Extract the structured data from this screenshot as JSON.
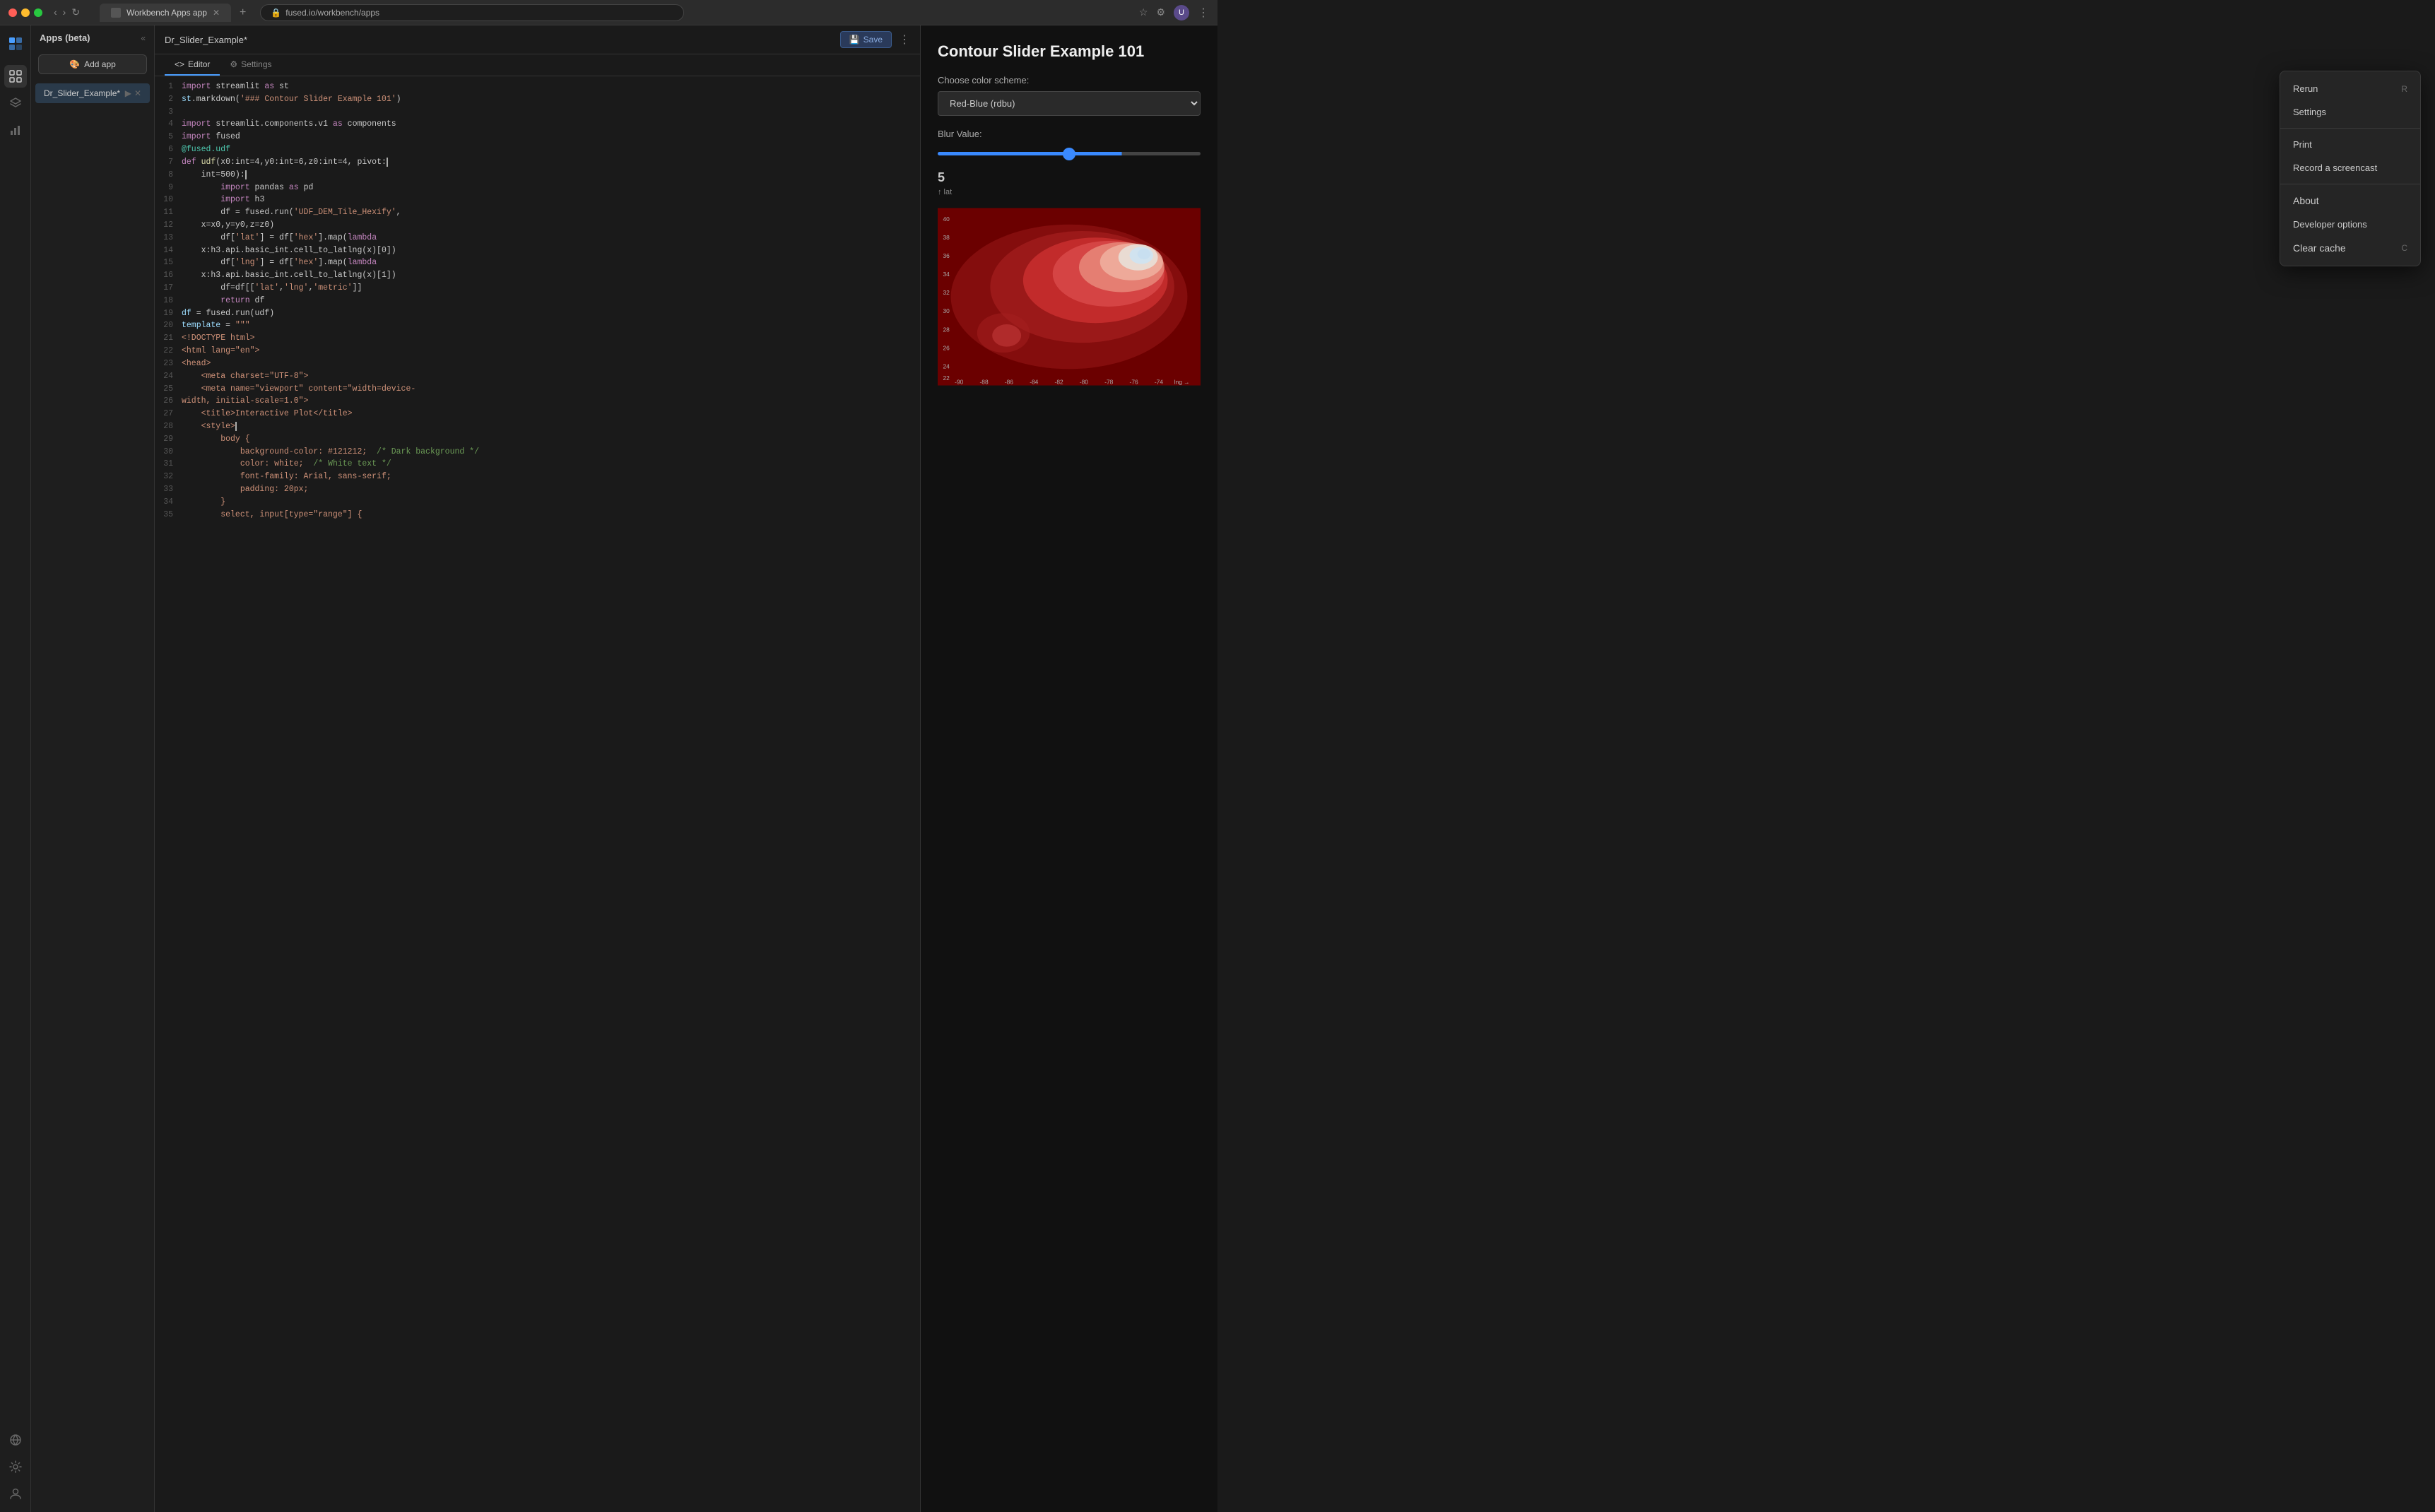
{
  "browser": {
    "tab_title": "Workbench Apps app",
    "url": "fused.io/workbench/apps",
    "new_tab_label": "+"
  },
  "sidebar": {
    "icons": [
      "grid",
      "layers",
      "chart",
      "tag",
      "globe",
      "settings",
      "user"
    ]
  },
  "left_panel": {
    "title": "Apps (beta)",
    "collapse_label": "«",
    "add_app_label": "Add app",
    "app_item": {
      "name": "Dr_Slider_Example*",
      "active": true
    }
  },
  "editor": {
    "filename": "Dr_Slider_Example*",
    "save_label": "Save",
    "menu_label": "⋮",
    "tabs": [
      {
        "label": "Editor",
        "icon": "<>",
        "active": true
      },
      {
        "label": "Settings",
        "icon": "⚙",
        "active": false
      }
    ],
    "lines": [
      {
        "num": 1,
        "tokens": [
          {
            "t": "kw",
            "v": "import"
          },
          {
            "t": "op",
            "v": " streamlit "
          },
          {
            "t": "kw",
            "v": "as"
          },
          {
            "t": "op",
            "v": " st"
          }
        ]
      },
      {
        "num": 2,
        "tokens": [
          {
            "t": "var",
            "v": "st"
          },
          {
            "t": "op",
            "v": ".markdown("
          },
          {
            "t": "str",
            "v": "'### Contour Slider Example 101'"
          },
          {
            "t": "op",
            "v": ")"
          }
        ]
      },
      {
        "num": 3,
        "tokens": []
      },
      {
        "num": 4,
        "tokens": [
          {
            "t": "kw",
            "v": "import"
          },
          {
            "t": "op",
            "v": " streamlit.components.v1 "
          },
          {
            "t": "kw",
            "v": "as"
          },
          {
            "t": "op",
            "v": " components"
          }
        ]
      },
      {
        "num": 5,
        "tokens": [
          {
            "t": "kw",
            "v": "import"
          },
          {
            "t": "op",
            "v": " fused"
          }
        ]
      },
      {
        "num": 6,
        "tokens": [
          {
            "t": "dec",
            "v": "@fused.udf"
          }
        ]
      },
      {
        "num": 7,
        "tokens": [
          {
            "t": "kw",
            "v": "def"
          },
          {
            "t": "op",
            "v": " "
          },
          {
            "t": "fn",
            "v": "udf"
          },
          {
            "t": "op",
            "v": "(x0:int=4,y0:int=6,z0:int=4, pivot:"
          }
        ]
      },
      {
        "num": 8,
        "tokens": [
          {
            "t": "op",
            "v": "    int=500):"
          }
        ]
      },
      {
        "num": 9,
        "tokens": [
          {
            "t": "op",
            "v": "        "
          },
          {
            "t": "kw",
            "v": "import"
          },
          {
            "t": "op",
            "v": " pandas "
          },
          {
            "t": "kw",
            "v": "as"
          },
          {
            "t": "op",
            "v": " pd"
          }
        ]
      },
      {
        "num": 10,
        "tokens": [
          {
            "t": "op",
            "v": "        "
          },
          {
            "t": "kw",
            "v": "import"
          },
          {
            "t": "op",
            "v": " h3"
          }
        ]
      },
      {
        "num": 11,
        "tokens": [
          {
            "t": "op",
            "v": "        df = fused.run("
          },
          {
            "t": "str",
            "v": "'UDF_DEM_Tile_Hexify'"
          },
          {
            "t": "op",
            "v": ","
          }
        ]
      },
      {
        "num": 12,
        "tokens": [
          {
            "t": "op",
            "v": "    x=x0,y=y0,z=z0)"
          }
        ]
      },
      {
        "num": 13,
        "tokens": [
          {
            "t": "op",
            "v": "        df["
          },
          {
            "t": "str",
            "v": "'lat'"
          },
          {
            "t": "op",
            "v": "] = df["
          },
          {
            "t": "str",
            "v": "'hex'"
          },
          {
            "t": "op",
            "v": "].map(lambda"
          }
        ]
      },
      {
        "num": 14,
        "tokens": [
          {
            "t": "op",
            "v": "    x:h3.api.basic_int.cell_to_latlng(x)[0])"
          }
        ]
      },
      {
        "num": 15,
        "tokens": [
          {
            "t": "op",
            "v": "        df["
          },
          {
            "t": "str",
            "v": "'lng'"
          },
          {
            "t": "op",
            "v": "] = df["
          },
          {
            "t": "str",
            "v": "'hex'"
          },
          {
            "t": "op",
            "v": "].map(lambda"
          }
        ]
      },
      {
        "num": 16,
        "tokens": [
          {
            "t": "op",
            "v": "    x:h3.api.basic_int.cell_to_latlng(x)[1])"
          }
        ]
      },
      {
        "num": 17,
        "tokens": [
          {
            "t": "op",
            "v": "        df=df[["
          },
          {
            "t": "str",
            "v": "'lat'"
          },
          {
            "t": "op",
            "v": ","
          },
          {
            "t": "str",
            "v": "'lng'"
          },
          {
            "t": "op",
            "v": ","
          },
          {
            "t": "str",
            "v": "'metric'"
          },
          {
            "t": "op",
            "v": "]]"
          }
        ]
      },
      {
        "num": 18,
        "tokens": [
          {
            "t": "op",
            "v": "        "
          },
          {
            "t": "kw",
            "v": "return"
          },
          {
            "t": "op",
            "v": " df"
          }
        ]
      },
      {
        "num": 19,
        "tokens": [
          {
            "t": "var",
            "v": "df"
          },
          {
            "t": "op",
            "v": " = fused.run(udf)"
          }
        ]
      },
      {
        "num": 20,
        "tokens": [
          {
            "t": "var",
            "v": "template"
          },
          {
            "t": "op",
            "v": " = "
          },
          {
            "t": "str",
            "v": "\"\"\""
          }
        ]
      },
      {
        "num": 21,
        "tokens": [
          {
            "t": "str",
            "v": "<!DOCTYPE html>"
          }
        ]
      },
      {
        "num": 22,
        "tokens": [
          {
            "t": "str",
            "v": "<html lang=\"en\">"
          }
        ]
      },
      {
        "num": 23,
        "tokens": [
          {
            "t": "str",
            "v": "<head>"
          }
        ]
      },
      {
        "num": 24,
        "tokens": [
          {
            "t": "str",
            "v": "    <meta charset=\"UTF-8\">"
          }
        ]
      },
      {
        "num": 25,
        "tokens": [
          {
            "t": "str",
            "v": "    <meta name=\"viewport\" content=\"width=device-"
          },
          {
            "t": "op",
            "v": ""
          }
        ]
      },
      {
        "num": 26,
        "tokens": [
          {
            "t": "str",
            "v": "width, initial-scale=1.0\">"
          }
        ]
      },
      {
        "num": 27,
        "tokens": [
          {
            "t": "str",
            "v": "    <title>Interactive Plot</title>"
          }
        ]
      },
      {
        "num": 28,
        "tokens": [
          {
            "t": "str",
            "v": "    <style>"
          }
        ]
      },
      {
        "num": 29,
        "tokens": [
          {
            "t": "str",
            "v": "        body {"
          }
        ]
      },
      {
        "num": 30,
        "tokens": [
          {
            "t": "str",
            "v": "            background-color: #121212;  /* Dark"
          },
          {
            "t": "cm",
            "v": " background */"
          }
        ]
      },
      {
        "num": 31,
        "tokens": [
          {
            "t": "str",
            "v": "            color: white;  "
          },
          {
            "t": "cm",
            "v": "/* White text */"
          }
        ]
      },
      {
        "num": 32,
        "tokens": [
          {
            "t": "str",
            "v": "            font-family: Arial, sans-serif;"
          }
        ]
      },
      {
        "num": 33,
        "tokens": [
          {
            "t": "str",
            "v": "            padding: 20px;"
          }
        ]
      },
      {
        "num": 34,
        "tokens": [
          {
            "t": "str",
            "v": "        }"
          }
        ]
      },
      {
        "num": 35,
        "tokens": [
          {
            "t": "str",
            "v": "        select, input[type=\"range\"] {"
          }
        ]
      }
    ]
  },
  "preview": {
    "title": "Contour Slider Example 101",
    "color_scheme_label": "Choose color scheme:",
    "color_scheme_value": "Red-Blue (rdbu)",
    "blur_label": "Blur Value:",
    "slider_value": "5",
    "lat_label": "↑ lat",
    "lng_label": "lng →",
    "x_axis": [
      "-90",
      "-88",
      "-86",
      "-84",
      "-82",
      "-80",
      "-78",
      "-76",
      "-74"
    ],
    "y_axis": [
      "40",
      "38",
      "36",
      "34",
      "32",
      "30",
      "28",
      "26",
      "24",
      "22"
    ]
  },
  "dropdown": {
    "items": [
      {
        "label": "Rerun",
        "shortcut": "R",
        "type": "item"
      },
      {
        "label": "Settings",
        "shortcut": "",
        "type": "item"
      },
      {
        "type": "divider"
      },
      {
        "label": "Print",
        "shortcut": "",
        "type": "item"
      },
      {
        "label": "Record a screencast",
        "shortcut": "",
        "type": "item"
      },
      {
        "type": "divider"
      },
      {
        "label": "About",
        "shortcut": "",
        "type": "item"
      },
      {
        "label": "Developer options",
        "shortcut": "",
        "type": "item"
      },
      {
        "label": "Clear cache",
        "shortcut": "C",
        "type": "item"
      }
    ]
  }
}
